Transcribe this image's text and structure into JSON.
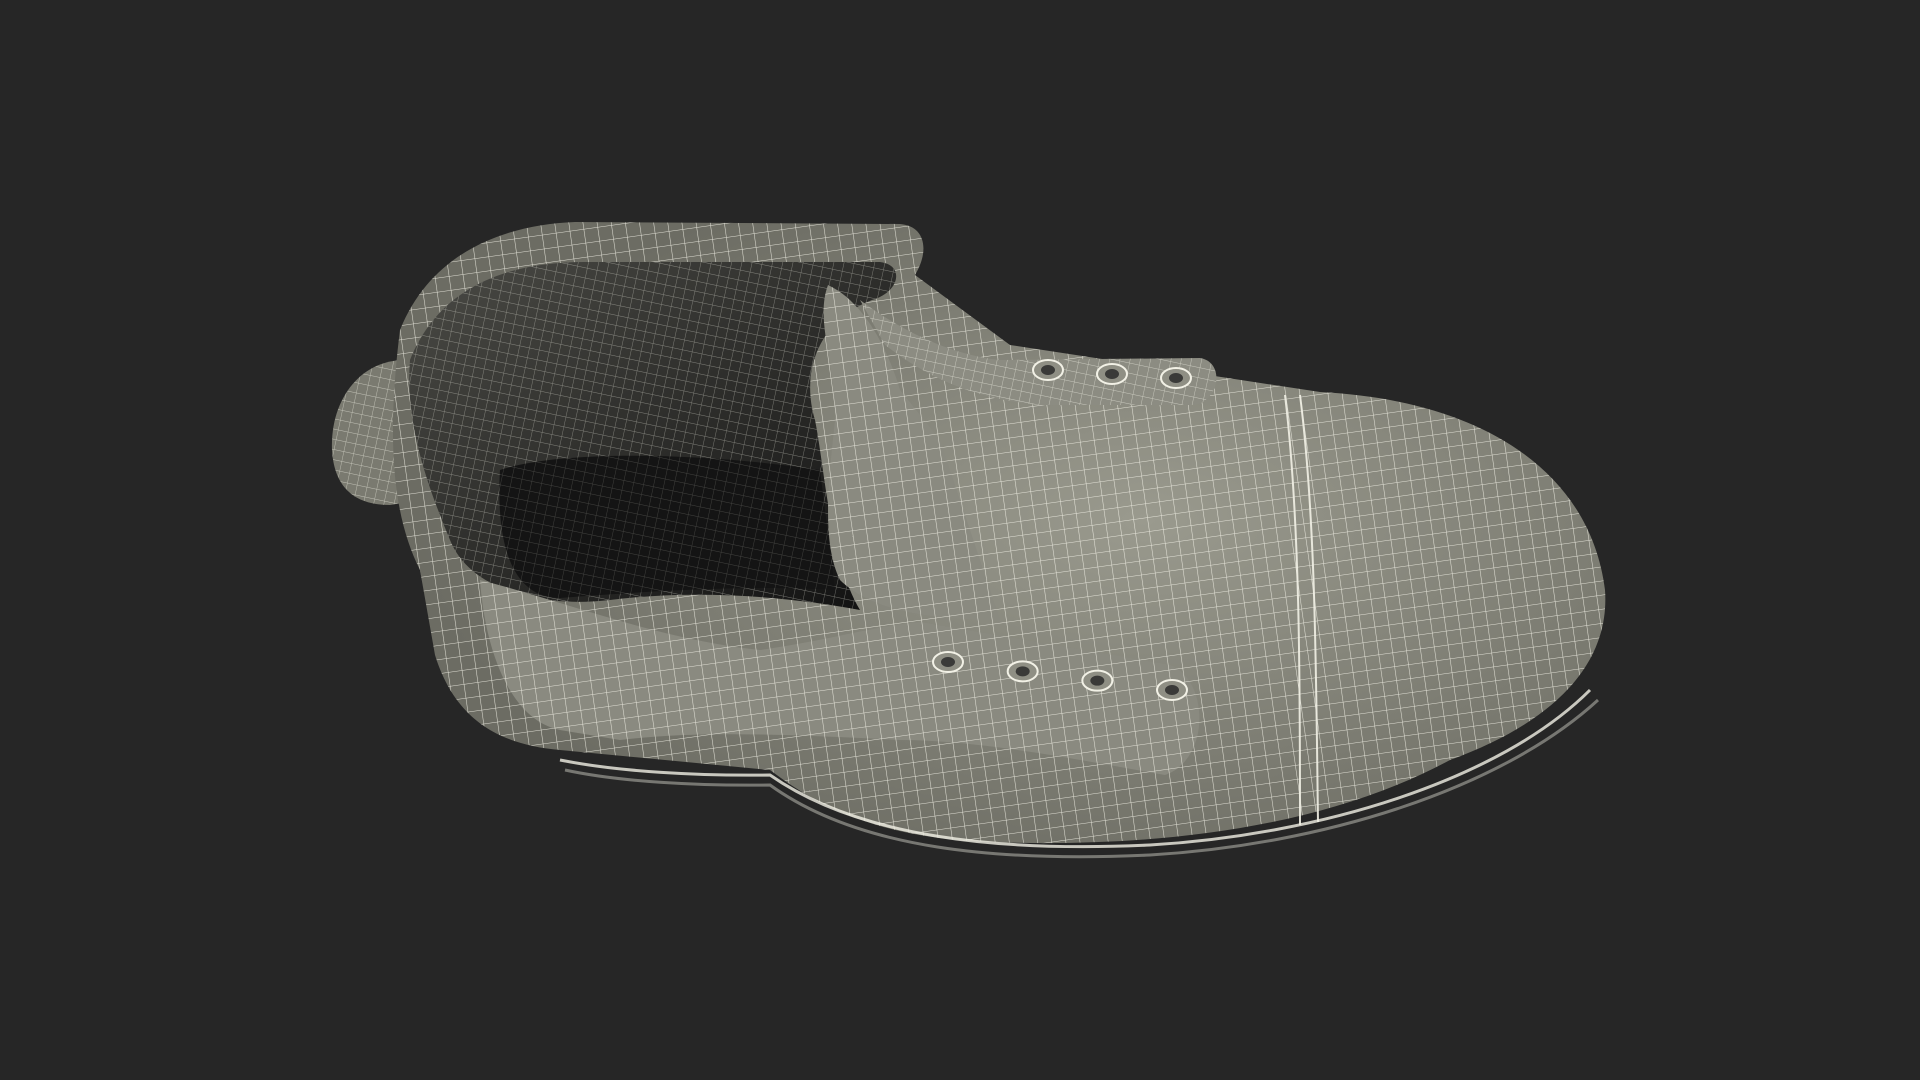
{
  "scene": {
    "subject": "boot-wireframe",
    "colors": {
      "background": "#262626",
      "surface": "#8f8f84",
      "surface_shadow": "#5e5e57",
      "interior": "#2a2a28",
      "interior_deep": "#151515",
      "wire": "#f2f1e6",
      "eyelet": "#3a3a38"
    },
    "eyelets": {
      "upper": 3,
      "lower": 4
    }
  }
}
